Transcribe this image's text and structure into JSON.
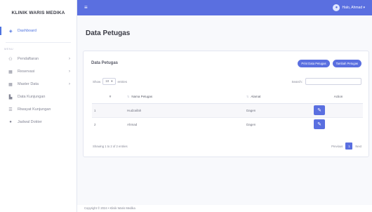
{
  "sidebar": {
    "brand": "KLINIK WARIS MEDIKA",
    "active": {
      "icon": "dashboard-icon",
      "label": "Dashboard"
    },
    "section_heading": "MENU",
    "items": [
      {
        "icon": "register-icon",
        "label": "Pendaftaran",
        "has_children": true
      },
      {
        "icon": "reservation-icon",
        "label": "Reservasi",
        "has_children": true
      },
      {
        "icon": "master-data-icon",
        "label": "Master Data",
        "has_children": true
      },
      {
        "icon": "visit-icon",
        "label": "Data Kunjungan",
        "has_children": false
      },
      {
        "icon": "history-icon",
        "label": "Riwayat Kunjungan",
        "has_children": false
      },
      {
        "icon": "schedule-icon",
        "label": "Jadwal Dokter",
        "has_children": false
      }
    ]
  },
  "topbar": {
    "user_label": "Halo, Ahmad ▾"
  },
  "page": {
    "title": "Data Petugas"
  },
  "card": {
    "title": "Data Petugas",
    "print_label": "Print Data Petugas",
    "add_label": "Tambah Petugas",
    "show_label": "Show",
    "entries_value": "10",
    "entries_label": "entries",
    "search_label": "Search:"
  },
  "table": {
    "headers": [
      "#",
      "Nama Petugas",
      "Alamat",
      "Action"
    ],
    "rows": [
      {
        "no": "1",
        "name": "Hudzaifah",
        "address": "Dagen"
      },
      {
        "no": "2",
        "name": "Ahmad",
        "address": "Dagen"
      }
    ]
  },
  "pagination": {
    "info": "Showing 1 to 2 of 2 entries",
    "previous": "Previous",
    "current": "1",
    "next": "Next"
  },
  "footer": {
    "copyright": "Copyright © 2024 • Klinik Waris Medika"
  },
  "colors": {
    "accent": "#5a6fe0",
    "background": "#f8f9fc"
  }
}
